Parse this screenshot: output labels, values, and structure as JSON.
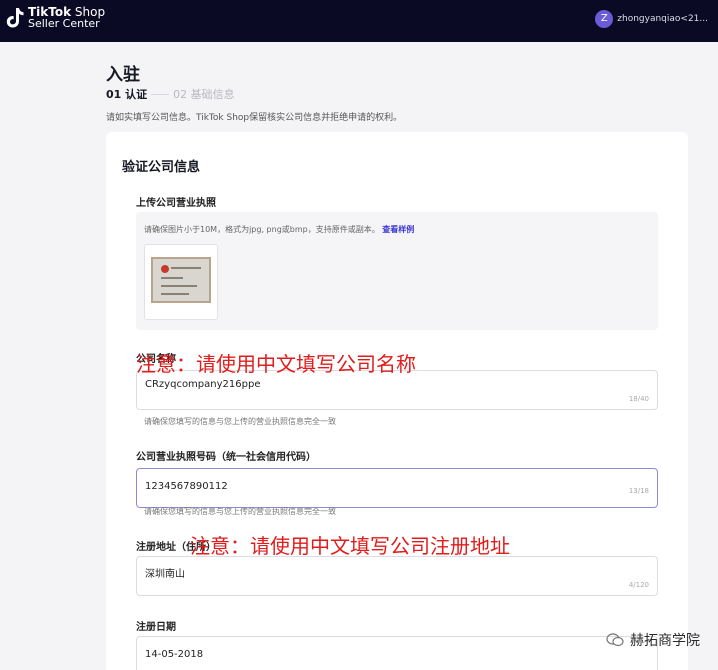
{
  "header": {
    "logo_line1_bold": "TikTok",
    "logo_line1_rest": " Shop",
    "logo_line2": "Seller Center",
    "avatar_letter": "Z",
    "username": "zhongyanqiao<21..."
  },
  "page": {
    "title": "入驻",
    "step1": "01 认证",
    "step2": "02 基础信息",
    "notice": "请如实填写公司信息。TikTok Shop保留核实公司信息并拒绝申请的权利。"
  },
  "card": {
    "title": "验证公司信息",
    "upload_label": "上传公司营业执照",
    "upload_hint": "请确保图片小于10M，格式为jpg, png或bmp，支持原件或副本。",
    "upload_example_link": "查看样例",
    "company_name_label": "公司名称",
    "company_name_value": "CRzyqcompany216ppe",
    "company_name_count": "18/40",
    "company_name_helper": "请确保您填写的信息与您上传的营业执照信息完全一致",
    "license_label": "公司营业执照号码（统一社会信用代码）",
    "license_value": "1234567890112",
    "license_count": "13/18",
    "license_helper": "请确保您填写的信息与您上传的营业执照信息完全一致",
    "address_label": "注册地址（住所）",
    "address_value": "深圳南山",
    "address_count": "4/120",
    "date_label": "注册日期",
    "date_value": "14-05-2018"
  },
  "annotations": {
    "note1": "注意：请使用中文填写公司名称",
    "note2": "注意：请使用中文填写公司注册地址"
  },
  "watermark": {
    "text": "赫拓商学院"
  },
  "colors": {
    "topbar": "#0b0a24",
    "accent": "#3b37d4",
    "annotation": "#e21b1b"
  }
}
